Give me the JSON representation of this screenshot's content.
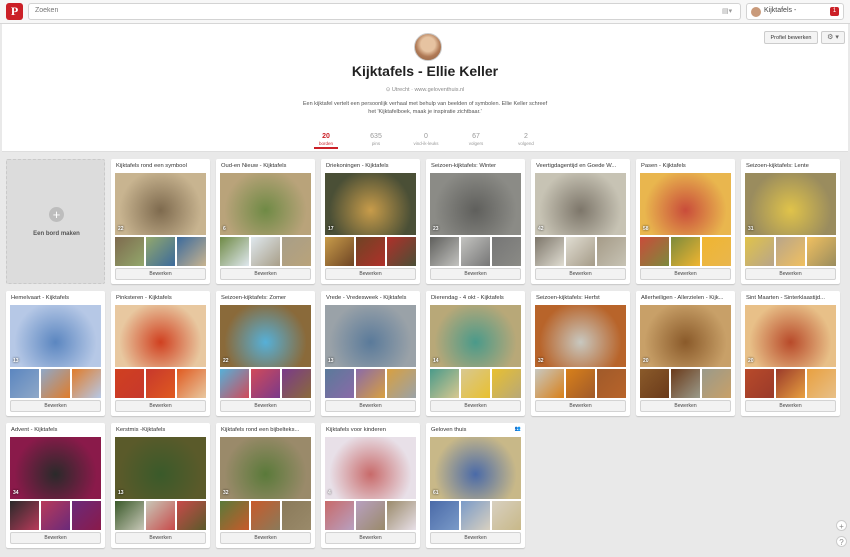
{
  "header": {
    "logo": "P",
    "search_placeholder": "Zoeken",
    "user_name": "Kijktafels -",
    "notifications": "1"
  },
  "profile": {
    "edit_label": "Profiel bewerken",
    "gear": "⚙ ▾",
    "name": "Kijktafels - Ellie Keller",
    "meta": "⊙ Utrecht · www.geloventhuis.nl",
    "description": "Een kijktafel vertelt een persoonlijk verhaal met behulp van beelden of symbolen. Ellie Keller schreef het 'Kijktafelboek, maak je inspiratie zichtbaar.'",
    "stats": [
      {
        "num": "20",
        "label": "borden",
        "active": true
      },
      {
        "num": "635",
        "label": "pins"
      },
      {
        "num": "0",
        "label": "vind-ik-leuks"
      },
      {
        "num": "67",
        "label": "volgers"
      },
      {
        "num": "2",
        "label": "volgend"
      }
    ]
  },
  "create_board_label": "Een bord maken",
  "edit_label": "Bewerken",
  "boards": [
    {
      "title": "Kijktafels rond een symbool",
      "count": "22",
      "colors": [
        "#c8b490",
        "#7e6a4e",
        "#93a86c",
        "#3b6a9c"
      ]
    },
    {
      "title": "Oud-en Nieuw - Kijktafels",
      "count": "6",
      "colors": [
        "#b9a37a",
        "#6f8a45",
        "#dfe8ee",
        "#a89e88"
      ]
    },
    {
      "title": "Driekoningen - Kijktafels",
      "count": "17",
      "colors": [
        "#4a4f36",
        "#c89c4a",
        "#6e4424",
        "#b0302a"
      ]
    },
    {
      "title": "Seizoen-kijktafels: Winter",
      "count": "23",
      "colors": [
        "#8b8b86",
        "#5f5f5c",
        "#c3c3c0",
        "#767676"
      ]
    },
    {
      "title": "Veertigdagentijd en Goede W...",
      "count": "42",
      "colors": [
        "#c7c3b4",
        "#7d766a",
        "#e0ddd2",
        "#a59b88"
      ]
    },
    {
      "title": "Pasen - Kijktafels",
      "count": "58",
      "colors": [
        "#e9b64e",
        "#c94c3a",
        "#7c8a3c",
        "#f0b530"
      ]
    },
    {
      "title": "Seizoen-kijktafels: Lente",
      "count": "31",
      "colors": [
        "#9a8c5e",
        "#e0c34a",
        "#b8a58a",
        "#f0c060"
      ]
    },
    {
      "title": "Hemelvaart - Kijktafels",
      "count": "13",
      "colors": [
        "#b6c8e6",
        "#5b86c0",
        "#8fa8c8",
        "#e07c2a"
      ]
    },
    {
      "title": "Pinksteren - Kijktafels",
      "count": "",
      "colors": [
        "#e8c8a0",
        "#d04020",
        "#c7382c",
        "#e05a20"
      ]
    },
    {
      "title": "Seizoen-kijktafels: Zomer",
      "count": "22",
      "colors": [
        "#8a6a3a",
        "#56b0d8",
        "#d04a5a",
        "#7a3a8a"
      ]
    },
    {
      "title": "Vrede - Vredesweek - Kijktafels",
      "count": "13",
      "colors": [
        "#9aa2a8",
        "#5a7a9a",
        "#8a6aa8",
        "#d8a040"
      ]
    },
    {
      "title": "Dierendag - 4 okt - Kijktafels",
      "count": "14",
      "colors": [
        "#b8a878",
        "#4a9a8a",
        "#d8c890",
        "#e8c030"
      ]
    },
    {
      "title": "Seizoen-kijktafels: Herfst",
      "count": "32",
      "colors": [
        "#b8642a",
        "#c8c8c0",
        "#d8801a",
        "#a05a2a"
      ]
    },
    {
      "title": "Allerheiligen - Allerzielen - Kijk...",
      "count": "20",
      "colors": [
        "#c8a068",
        "#8a5a2a",
        "#6a3a1a",
        "#9a9a8a"
      ]
    },
    {
      "title": "Sint Maarten - Sinterklaastijd...",
      "count": "20",
      "colors": [
        "#e8c088",
        "#b84a2a",
        "#9a3a2a",
        "#e8a040"
      ]
    },
    {
      "title": "Advent - Kijktafels",
      "count": "34",
      "colors": [
        "#8a1a4a",
        "#2a2a2a",
        "#b83a5a",
        "#6a2a7a"
      ]
    },
    {
      "title": "Kerstmis -Kijktafels",
      "count": "13",
      "colors": [
        "#5a5a2a",
        "#3a5a2a",
        "#c8c8b8",
        "#c84a4a"
      ]
    },
    {
      "title": "Kijktafels rond een bijbelteks...",
      "count": "32",
      "colors": [
        "#9a8a6a",
        "#5a7a3a",
        "#c85a2a",
        "#8a7a5a"
      ]
    },
    {
      "title": "Kijktafels voor kinderen",
      "count": "4",
      "colors": [
        "#e8e0e8",
        "#c86a6a",
        "#b8a0c0",
        "#9a8a6a"
      ]
    },
    {
      "title": "Geloven thuis",
      "count": "61",
      "colors": [
        "#c8b888",
        "#4a6aa8",
        "#7a9ac8",
        "#d8d0c0"
      ],
      "shared": "👥"
    }
  ]
}
